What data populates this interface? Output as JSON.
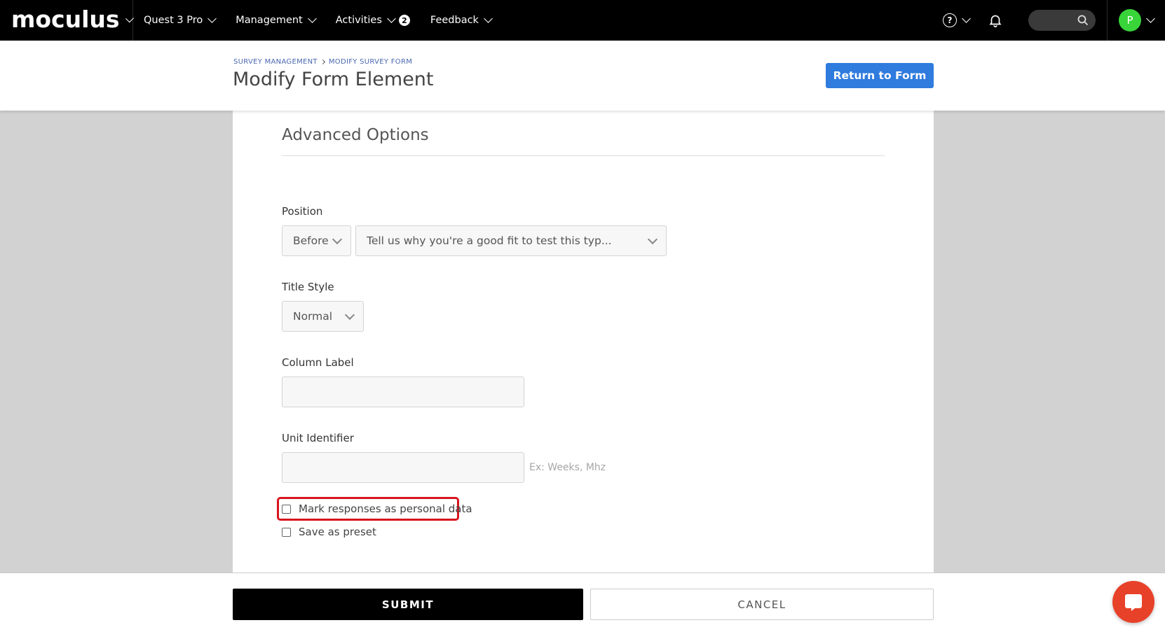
{
  "nav": {
    "brand": "moculus",
    "items": [
      {
        "label": "Quest 3 Pro"
      },
      {
        "label": "Management"
      },
      {
        "label": "Activities",
        "badge": "2"
      },
      {
        "label": "Feedback"
      }
    ],
    "help_glyph": "?",
    "avatar_initial": "P",
    "avatar_color": "#38d43a"
  },
  "header": {
    "breadcrumb": [
      "SURVEY MANAGEMENT",
      "MODIFY SURVEY FORM"
    ],
    "title": "Modify Form Element",
    "return_button": "Return to Form",
    "accent": "#2f7bde"
  },
  "form": {
    "section_title": "Advanced Options",
    "position": {
      "label": "Position",
      "relation_value": "Before",
      "target_value": "Tell us why you're a good fit to test this typ..."
    },
    "title_style": {
      "label": "Title Style",
      "value": "Normal"
    },
    "column_label": {
      "label": "Column Label",
      "value": ""
    },
    "unit_identifier": {
      "label": "Unit Identifier",
      "value": "",
      "hint": "Ex: Weeks, Mhz"
    },
    "checkboxes": [
      {
        "label": "Mark responses as personal data",
        "checked": false,
        "highlighted": true
      },
      {
        "label": "Save as preset",
        "checked": false,
        "highlighted": false
      }
    ],
    "highlight_color": "#d8151d"
  },
  "footer": {
    "submit": "SUBMIT",
    "cancel": "CANCEL",
    "chat_color": "#e8412a"
  }
}
